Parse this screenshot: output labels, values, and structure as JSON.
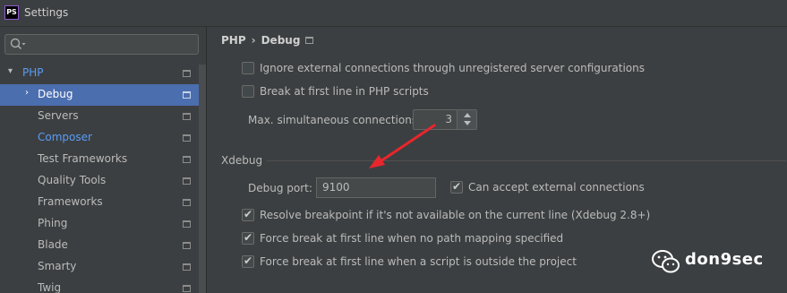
{
  "window": {
    "app_icon": "PS",
    "title": "Settings"
  },
  "sidebar": {
    "search": {
      "value": "",
      "placeholder": ""
    },
    "items": [
      {
        "label": "PHP",
        "expanded": true,
        "accent": "#589df6"
      },
      {
        "label": "Debug",
        "selected": true
      },
      {
        "label": "Servers"
      },
      {
        "label": "Composer",
        "accent": "#589df6"
      },
      {
        "label": "Test Frameworks"
      },
      {
        "label": "Quality Tools"
      },
      {
        "label": "Frameworks"
      },
      {
        "label": "Phing"
      },
      {
        "label": "Blade"
      },
      {
        "label": "Smarty"
      },
      {
        "label": "Twig"
      }
    ]
  },
  "breadcrumb": {
    "parent": "PHP",
    "separator": "›",
    "current": "Debug"
  },
  "general": {
    "ignore_external": {
      "label": "Ignore external connections through unregistered server configurations",
      "checked": false
    },
    "break_first_line": {
      "label": "Break at first line in PHP scripts",
      "checked": false
    },
    "max_connections": {
      "label": "Max. simultaneous connections:",
      "value": "3"
    }
  },
  "xdebug": {
    "section_title": "Xdebug",
    "debug_port": {
      "label": "Debug port:",
      "value": "9100"
    },
    "accept_external": {
      "label": "Can accept external connections",
      "checked": true
    },
    "resolve_breakpoint": {
      "label": "Resolve breakpoint if it's not available on the current line (Xdebug 2.8+)",
      "checked": true
    },
    "force_break_no_mapping": {
      "label": "Force break at first line when no path mapping specified",
      "checked": true
    },
    "force_break_outside": {
      "label": "Force break at first line when a script is outside the project",
      "checked": true
    }
  },
  "annotation": {
    "color": "#e8262d"
  },
  "watermark": {
    "text": "don9sec"
  },
  "colors": {
    "background": "#3c3f41",
    "selection": "#4b6eaf",
    "link_blue": "#589df6"
  }
}
